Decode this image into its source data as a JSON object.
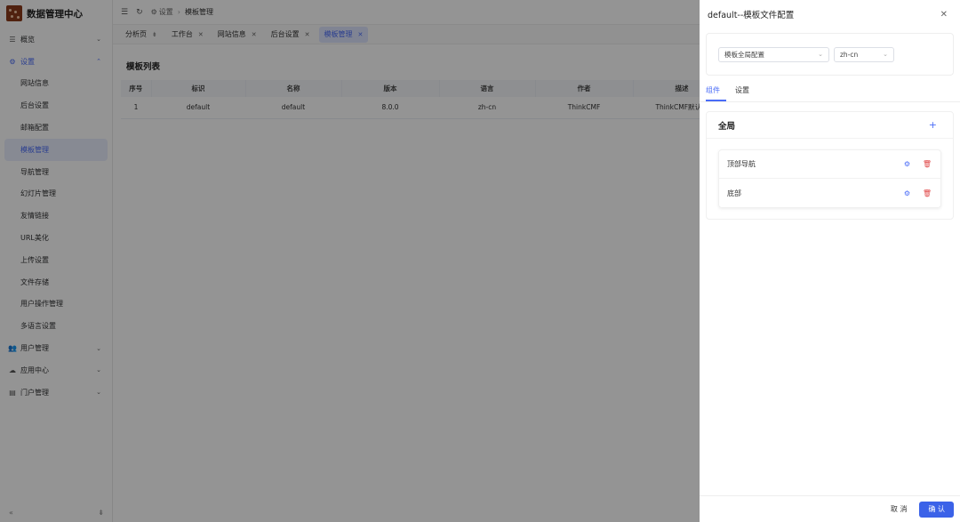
{
  "app": {
    "title": "数据管理中心"
  },
  "sidebar": {
    "items": [
      {
        "icon": "menu-icon",
        "label": "概览",
        "arrow": "⌄"
      },
      {
        "icon": "gears-icon",
        "label": "设置",
        "arrow": "⌃"
      },
      {
        "label": "网站信息"
      },
      {
        "label": "后台设置"
      },
      {
        "label": "邮箱配置"
      },
      {
        "label": "模板管理"
      },
      {
        "label": "导航管理"
      },
      {
        "label": "幻灯片管理"
      },
      {
        "label": "友情链接"
      },
      {
        "label": "URL美化"
      },
      {
        "label": "上传设置"
      },
      {
        "label": "文件存储"
      },
      {
        "label": "用户操作管理"
      },
      {
        "label": "多语言设置"
      },
      {
        "icon": "users-icon",
        "label": "用户管理",
        "arrow": "⌄"
      },
      {
        "icon": "cloud-icon",
        "label": "应用中心",
        "arrow": "⌄"
      },
      {
        "icon": "file-icon",
        "label": "门户管理",
        "arrow": "⌄"
      }
    ]
  },
  "header": {
    "breadcrumb": [
      "设置",
      "模板管理"
    ]
  },
  "tabs": [
    {
      "label": "分析页"
    },
    {
      "label": "工作台"
    },
    {
      "label": "网站信息"
    },
    {
      "label": "后台设置"
    },
    {
      "label": "模板管理"
    }
  ],
  "content": {
    "title": "模板列表",
    "columns": [
      "序号",
      "标识",
      "名称",
      "版本",
      "语言",
      "作者",
      "描述"
    ],
    "rows": [
      [
        "1",
        "default",
        "default",
        "8.0.0",
        "zh-cn",
        "ThinkCMF",
        "ThinkCMF默认模"
      ]
    ]
  },
  "drawer": {
    "title": "default--模板文件配置",
    "select_scope": "模板全局配置",
    "select_lang": "zh-cn",
    "tabs": [
      "组件",
      "设置"
    ],
    "section_title": "全局",
    "items": [
      "顶部导航",
      "底部"
    ],
    "cancel_label": "取 消",
    "ok_label": "确 认"
  },
  "colors": {
    "accent": "#4a6cf7",
    "danger": "#e04848",
    "logo": "#8b3a1a"
  }
}
